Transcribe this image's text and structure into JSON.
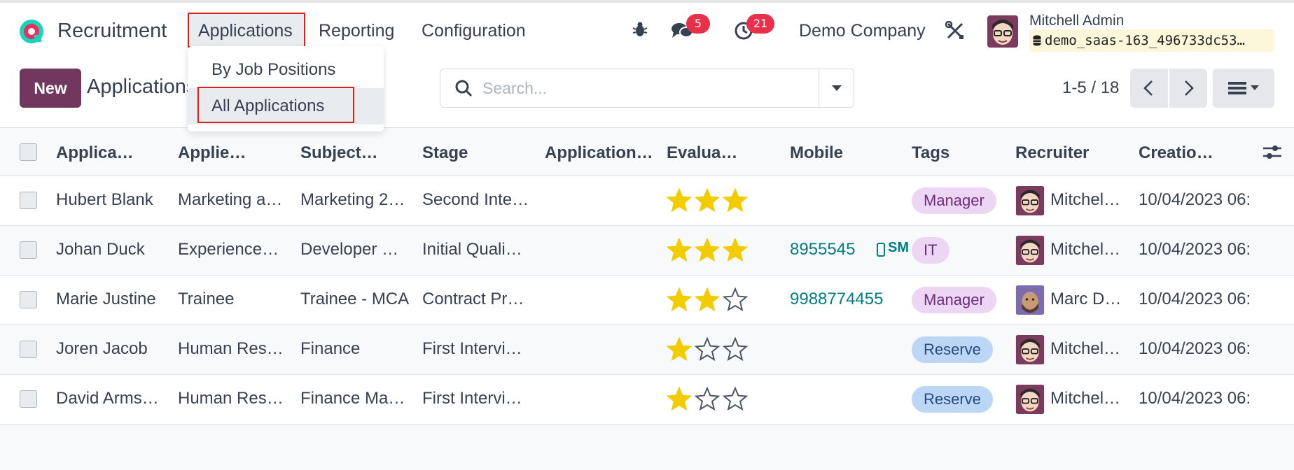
{
  "navbar": {
    "app_name": "Recruitment",
    "menu": {
      "applications": "Applications",
      "reporting": "Reporting",
      "configuration": "Configuration"
    },
    "messages_count": "5",
    "activities_count": "21",
    "company": "Demo Company",
    "user_name": "Mitchell Admin",
    "database": "demo_saas-163_496733dc53…"
  },
  "dropdown": {
    "items": [
      "By Job Positions",
      "All Applications"
    ]
  },
  "control": {
    "new_label": "New",
    "breadcrumb": "Applications",
    "search_placeholder": "Search...",
    "pager": "1-5 / 18"
  },
  "table": {
    "columns": [
      "Applica…",
      "Applie…",
      "Subject…",
      "Stage",
      "Application…",
      "Evalua…",
      "Mobile",
      "Tags",
      "Recruiter",
      "Creatio…"
    ],
    "rows": [
      {
        "name": "Hubert Blank",
        "applied": "Marketing a…",
        "subject": "Marketing 2…",
        "stage": "Second Inte…",
        "stars": 3,
        "mobile": "",
        "sms": "",
        "tag": "Manager",
        "tag_kind": "manager",
        "recruiter": "Mitchel…",
        "date": "10/04/2023 06:"
      },
      {
        "name": "Johan Duck",
        "applied": "Experience…",
        "subject": "Developer …",
        "stage": "Initial Quali…",
        "stars": 3,
        "mobile": "8955545",
        "sms": "SMS",
        "tag": "IT",
        "tag_kind": "it",
        "recruiter": "Mitchel…",
        "date": "10/04/2023 06:"
      },
      {
        "name": "Marie Justine",
        "applied": "Trainee",
        "subject": "Trainee - MCA",
        "stage": "Contract Pr…",
        "stars": 2,
        "mobile": "9988774455",
        "sms": "",
        "tag": "Manager",
        "tag_kind": "manager",
        "recruiter": "Marc D…",
        "date": "10/04/2023 06:"
      },
      {
        "name": "Joren Jacob",
        "applied": "Human Res…",
        "subject": "Finance",
        "stage": "First Intervi…",
        "stars": 1,
        "mobile": "",
        "sms": "",
        "tag": "Reserve",
        "tag_kind": "reserve",
        "recruiter": "Mitchel…",
        "date": "10/04/2023 06:"
      },
      {
        "name": "David Arms…",
        "applied": "Human Res…",
        "subject": "Finance Ma…",
        "stage": "First Intervi…",
        "stars": 1,
        "mobile": "",
        "sms": "",
        "tag": "Reserve",
        "tag_kind": "reserve",
        "recruiter": "Mitchel…",
        "date": "10/04/2023 06:"
      }
    ]
  },
  "colors": {
    "brand": "#71375e",
    "star": "#f3cc00",
    "link": "#017e84",
    "badge": "#e8304a",
    "highlight": "#e0201b"
  },
  "icons": [
    "recruitment-logo",
    "bug-icon",
    "chat-icon",
    "clock-icon",
    "tools-icon",
    "database-icon",
    "search-icon",
    "caret-down-icon",
    "chevron-left-icon",
    "chevron-right-icon",
    "list-view-icon",
    "optional-columns-icon",
    "star-icon",
    "mobile-icon"
  ]
}
